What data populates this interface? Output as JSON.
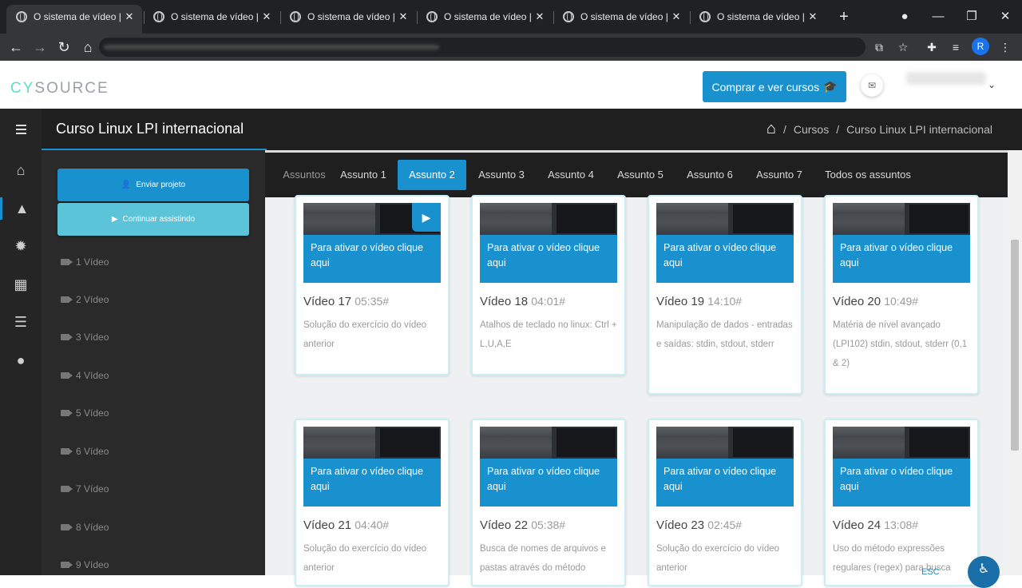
{
  "browser": {
    "tabs": [
      {
        "title": "O sistema de vídeo | C",
        "active": true
      },
      {
        "title": "O sistema de vídeo | C",
        "active": false
      },
      {
        "title": "O sistema de vídeo | C",
        "active": false
      },
      {
        "title": "O sistema de vídeo | C",
        "active": false
      },
      {
        "title": "O sistema de vídeo | C",
        "active": false
      },
      {
        "title": "O sistema de vídeo | C",
        "active": false
      }
    ],
    "new_tab": "+",
    "profile_initial": "R"
  },
  "header": {
    "logo_prefix": "CY",
    "logo_suffix": "SOURCE",
    "buy_button": "Comprar e ver cursos",
    "accent_color": "#1a91cf"
  },
  "course": {
    "title": "Curso Linux LPI internacional",
    "breadcrumb": {
      "separator": "/",
      "items": [
        "Cursos",
        "Curso Linux LPI internacional"
      ]
    }
  },
  "left_panel": {
    "send_project": "Enviar projeto",
    "continue_watching": "Continuar assistindo",
    "videos": [
      "1 Vídeo",
      "2 Vídeo",
      "3 Vídeo",
      "4 Vídeo",
      "5 Vídeo",
      "6 Vídeo",
      "7 Vídeo",
      "8 Vídeo",
      "9 Vídeo"
    ]
  },
  "topics": {
    "label": "Assuntos",
    "items": [
      "Assunto 1",
      "Assunto 2",
      "Assunto 3",
      "Assunto 4",
      "Assunto 5",
      "Assunto 6",
      "Assunto 7",
      "Todos os assuntos"
    ],
    "active": "Assunto 2"
  },
  "cards": [
    {
      "overlay": "Para ativar o vídeo clique aqui",
      "title": "Vídeo 17",
      "duration": "05:35#",
      "desc": "Solução do exercício do vídeo anterior"
    },
    {
      "overlay": "Para ativar o vídeo clique aqui",
      "title": "Vídeo 18",
      "duration": "04:01#",
      "desc": "Atalhos de teclado no linux: Ctrl + L,U,A,E"
    },
    {
      "overlay": "Para ativar o vídeo clique aqui",
      "title": "Vídeo 19",
      "duration": "14:10#",
      "desc": "Manipulação de dados - entradas e saídas: stdin, stdout, stderr"
    },
    {
      "overlay": "Para ativar o vídeo clique aqui",
      "title": "Vídeo 20",
      "duration": "10:49#",
      "desc": "Matéria de nível avançado (LPI102) stdin, stdout, stderr (0,1 & 2)"
    },
    {
      "overlay": "Para ativar o vídeo clique aqui",
      "title": "Vídeo 21",
      "duration": "04:40#",
      "desc": "Solução do exercício do vídeo anterior"
    },
    {
      "overlay": "Para ativar o vídeo clique aqui",
      "title": "Vídeo 22",
      "duration": "05:38#",
      "desc": "Busca de nomes de arquivos e pastas através do método"
    },
    {
      "overlay": "Para ativar o vídeo clique aqui",
      "title": "Vídeo 23",
      "duration": "02:45#",
      "desc": "Solução do exercício do vídeo anterior"
    },
    {
      "overlay": "Para ativar o vídeo clique aqui",
      "title": "Vídeo 24",
      "duration": "13:08#",
      "desc": "Uso do método expressões regulares (regex) para busca"
    }
  ],
  "accessibility": {
    "esc_label": "ESC"
  }
}
